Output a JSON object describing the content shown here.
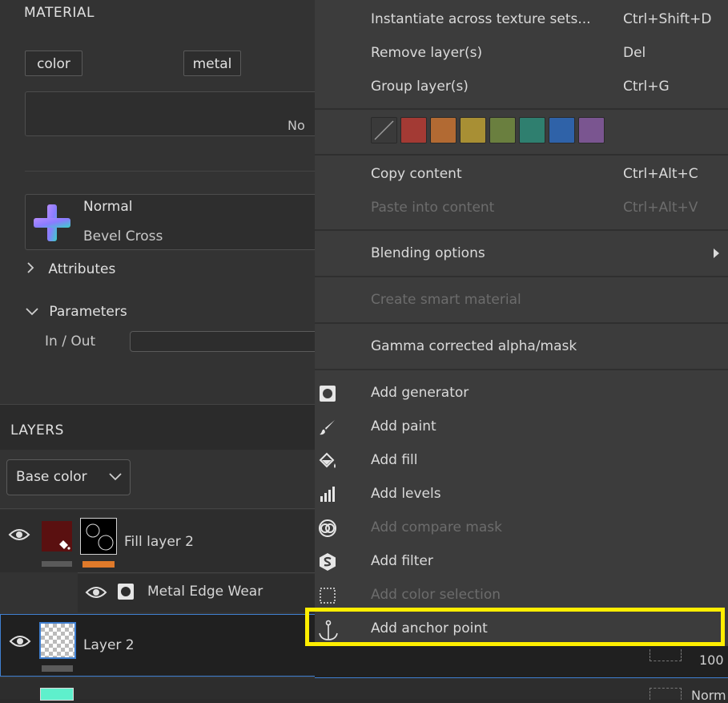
{
  "material": {
    "title": "MATERIAL",
    "chips": [
      "color",
      "metal"
    ],
    "box_partial_text": "No",
    "preset_mode": "Normal",
    "preset_name": "Bevel Cross",
    "attributes_label": "Attributes",
    "parameters_label": "Parameters",
    "in_out_label": "In / Out"
  },
  "layers": {
    "title": "LAYERS",
    "channel_select": "Base color",
    "items": [
      {
        "name": "Fill layer 2"
      },
      {
        "name": "Metal Edge Wear"
      },
      {
        "name": "Layer 2",
        "opacity": "100"
      },
      {
        "name": "",
        "blend_partial": "Norm"
      }
    ]
  },
  "menu": {
    "items": [
      {
        "label": "Instantiate across texture sets...",
        "shortcut": "Ctrl+Shift+D"
      },
      {
        "label": "Remove layer(s)",
        "shortcut": "Del"
      },
      {
        "label": "Group layer(s)",
        "shortcut": "Ctrl+G"
      },
      {
        "label": "Copy content",
        "shortcut": "Ctrl+Alt+C"
      },
      {
        "label": "Paste into content",
        "shortcut": "Ctrl+Alt+V"
      },
      {
        "label": "Blending options",
        "shortcut": ""
      },
      {
        "label": "Create smart material",
        "shortcut": ""
      },
      {
        "label": "Gamma corrected alpha/mask",
        "shortcut": ""
      },
      {
        "label": "Add generator",
        "icon": "generator-icon"
      },
      {
        "label": "Add paint",
        "icon": "brush-icon"
      },
      {
        "label": "Add fill",
        "icon": "fill-bucket-icon"
      },
      {
        "label": "Add levels",
        "icon": "levels-icon"
      },
      {
        "label": "Add compare mask",
        "icon": "compare-mask-icon"
      },
      {
        "label": "Add filter",
        "icon": "filter-icon"
      },
      {
        "label": "Add color selection",
        "icon": "color-selection-icon"
      },
      {
        "label": "Add anchor point",
        "icon": "anchor-icon"
      }
    ],
    "swatches": [
      "#3a3a3a",
      "#a33a34",
      "#b26a33",
      "#a88f34",
      "#6a7f3f",
      "#2f7f6f",
      "#2f62a8",
      "#7a5590"
    ]
  },
  "colors": {
    "highlight": "#ffee00",
    "selection_border": "#3f7fd0",
    "fill_thumb": "#5a1010",
    "accent_bar": "#e07a2a",
    "next_layer_thumb": "#5ef0cc"
  }
}
